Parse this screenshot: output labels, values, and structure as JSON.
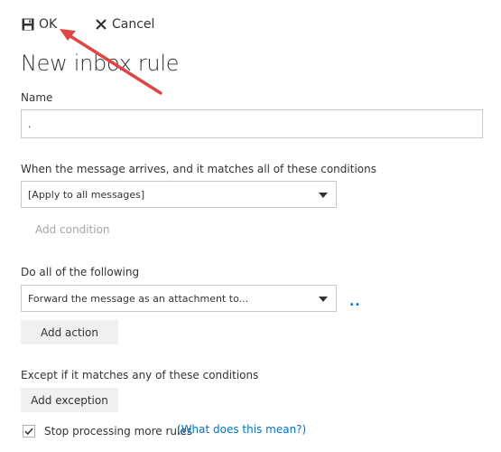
{
  "toolbar": {
    "ok_label": "OK",
    "cancel_label": "Cancel"
  },
  "page_title": "New inbox rule",
  "name_section": {
    "label": "Name",
    "value": "."
  },
  "conditions_section": {
    "label": "When the message arrives, and it matches all of these conditions",
    "selected": "[Apply to all messages]",
    "add_condition_label": "Add condition"
  },
  "actions_section": {
    "label": "Do all of the following",
    "selected": "Forward the message as an attachment to...",
    "more_indicator": "..",
    "add_action_label": "Add action"
  },
  "exceptions_section": {
    "label": "Except if it matches any of these conditions",
    "add_exception_label": "Add exception"
  },
  "stop_processing": {
    "label": "Stop processing more rules",
    "checked": true,
    "help_link": "(What does this mean?)"
  },
  "colors": {
    "annotation_arrow": "#e04545",
    "link": "#0072c6"
  }
}
